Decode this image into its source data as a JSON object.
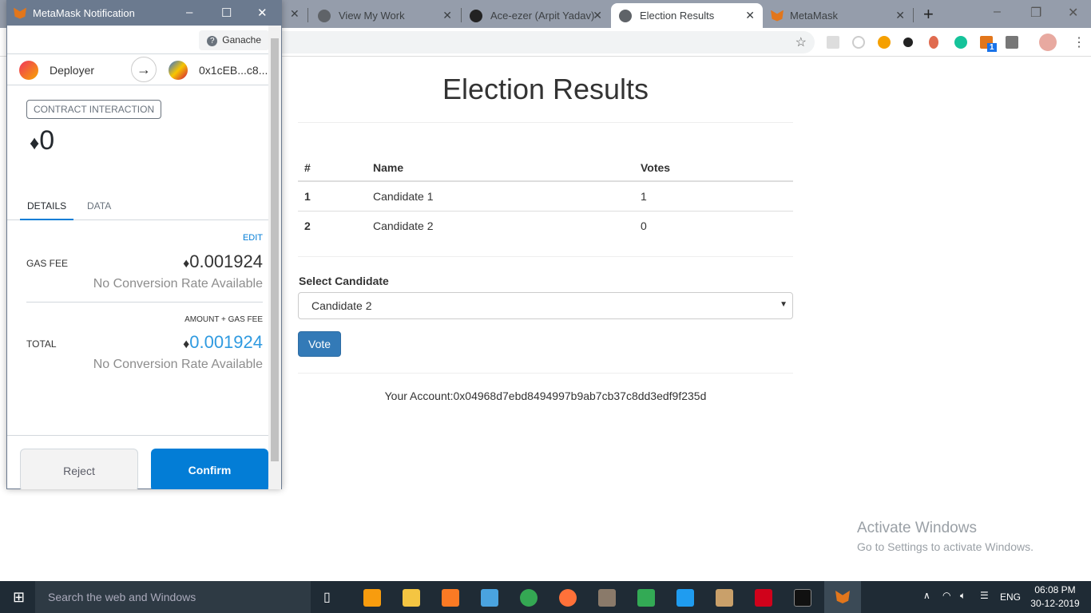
{
  "browser": {
    "tabs": [
      {
        "label": "View My Work",
        "icon": "globe-icon"
      },
      {
        "label": "Ace-ezer (Arpit Yadav)",
        "icon": "github-icon"
      },
      {
        "label": "Election Results",
        "icon": "globe-icon",
        "active": true
      },
      {
        "label": "MetaMask",
        "icon": "metamask-fox-icon"
      }
    ],
    "new_tab": "+",
    "extension_badge": "1"
  },
  "page": {
    "title": "Election Results",
    "table": {
      "headers": [
        "#",
        "Name",
        "Votes"
      ],
      "rows": [
        [
          "1",
          "Candidate 1",
          "1"
        ],
        [
          "2",
          "Candidate 2",
          "0"
        ]
      ]
    },
    "select_label": "Select Candidate",
    "select_value": "Candidate 2",
    "vote_button": "Vote",
    "account": "Your Account:0x04968d7ebd8494997b9ab7cb37c8dd3edf9f235d"
  },
  "metamask": {
    "window_title": "MetaMask Notification",
    "network": "Ganache",
    "from": "Deployer",
    "to": "0x1cEB...c8...",
    "badge": "CONTRACT INTERACTION",
    "amount": "0",
    "tabs": [
      "DETAILS",
      "DATA"
    ],
    "edit": "EDIT",
    "gas_fee_label": "GAS FEE",
    "gas_fee": "0.001924",
    "no_conversion": "No Conversion Rate Available",
    "amount_gas_label": "AMOUNT + GAS FEE",
    "total_label": "TOTAL",
    "total": "0.001924",
    "reject": "Reject",
    "confirm": "Confirm",
    "accent": "#037dd6"
  },
  "watermark": {
    "title": "Activate Windows",
    "subtitle": "Go to Settings to activate Windows."
  },
  "taskbar": {
    "search": "Search the web and Windows",
    "lang": "ENG",
    "time": "06:08 PM",
    "date": "30-12-2019"
  }
}
